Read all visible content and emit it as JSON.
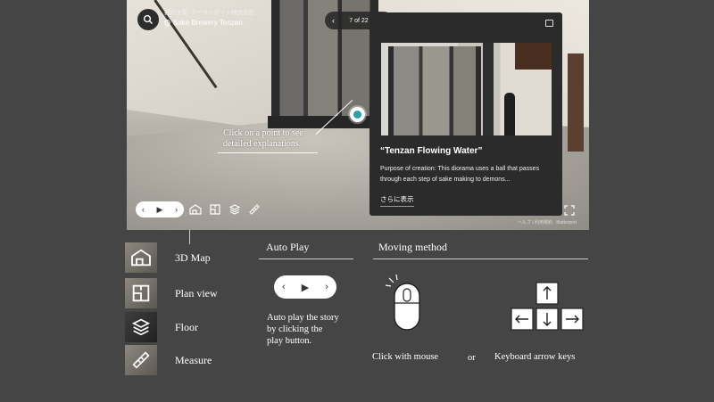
{
  "viewer": {
    "provider_label": "提供企業: マーターポート株式会社",
    "location_label": "Sake Brewery Tenzan",
    "pager_text": "7 of 22",
    "hint_text_line1": "Click on a point to see",
    "hint_text_line2": "detailed explanations.",
    "footer_help": "ヘルプ",
    "footer_terms": "利用規約",
    "footer_brand": "Matterport"
  },
  "panel": {
    "title": "“Tenzan Flowing Water”",
    "body": "Purpose of creation: This diorama uses a ball that passes through each step of sake making to demons...",
    "more_label": "さらに表示"
  },
  "legend": {
    "items": [
      {
        "label": "3D Map",
        "icon": "dollhouse-icon"
      },
      {
        "label": "Plan view",
        "icon": "floorplan-icon"
      },
      {
        "label": "Floor",
        "icon": "floor-layers-icon"
      },
      {
        "label": "Measure",
        "icon": "ruler-icon"
      }
    ]
  },
  "autoplay": {
    "heading": "Auto Play",
    "desc_line1": "Auto play the story",
    "desc_line2": "by clicking the",
    "desc_line3": "play button."
  },
  "moving": {
    "heading": "Moving method",
    "mouse_label": "Click with mouse",
    "or_label": "or",
    "keyboard_label": "Keyboard arrow keys"
  },
  "colors": {
    "background": "#454545",
    "panel": "#2b2b2b",
    "hotspot_accent": "#2a9fb0"
  }
}
